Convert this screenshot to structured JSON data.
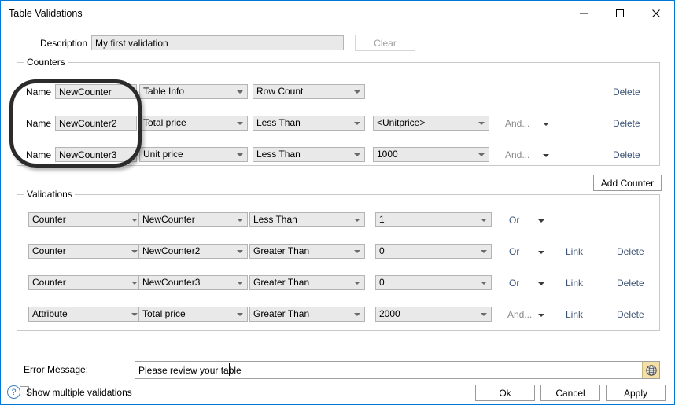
{
  "window": {
    "title": "Table Validations",
    "accent_color": "#0078d7",
    "caption_buttons": [
      {
        "name": "minimize-button",
        "glyph": "minimize-icon"
      },
      {
        "name": "maximize-button",
        "glyph": "maximize-icon"
      },
      {
        "name": "close-button",
        "glyph": "close-icon"
      }
    ]
  },
  "description": {
    "label": "Description",
    "value": "My first validation",
    "placeholder": "",
    "clear_label": "Clear",
    "clear_enabled": false
  },
  "counters": {
    "group_label": "Counters",
    "name_label": "Name",
    "add_button_label": "Add Counter",
    "rows": [
      {
        "name_value": "NewCounter",
        "source": "Table Info",
        "metric": "Row Count",
        "value": "",
        "connector": "",
        "delete_label": "Delete"
      },
      {
        "name_value": "NewCounter2",
        "source": "Total price",
        "metric": "Less Than",
        "value": "<Unitprice>",
        "connector": "And...",
        "delete_label": "Delete"
      },
      {
        "name_value": "NewCounter3",
        "source": "Unit price",
        "metric": "Less Than",
        "value": "1000",
        "connector": "And...",
        "delete_label": "Delete"
      }
    ]
  },
  "validations": {
    "group_label": "Validations",
    "rows": [
      {
        "type": "Counter",
        "target": "NewCounter",
        "operator": "Less Than",
        "value": "1",
        "connector": "Or",
        "link_label": "",
        "delete_label": ""
      },
      {
        "type": "Counter",
        "target": "NewCounter2",
        "operator": "Greater Than",
        "value": "0",
        "connector": "Or",
        "link_label": "Link",
        "delete_label": "Delete"
      },
      {
        "type": "Counter",
        "target": "NewCounter3",
        "operator": "Greater Than",
        "value": "0",
        "connector": "Or",
        "link_label": "Link",
        "delete_label": "Delete"
      },
      {
        "type": "Attribute",
        "target": "Total price",
        "operator": "Greater Than",
        "value": "2000",
        "connector": "And...",
        "link_label": "Link",
        "delete_label": "Delete"
      }
    ]
  },
  "error_message": {
    "label": "Error Message:",
    "value": "Please review your table",
    "placeholder": "",
    "globe_icon": "globe-icon"
  },
  "footer": {
    "help_icon": "help-icon",
    "show_multiple_label": "Show multiple validations",
    "show_multiple_checked": false,
    "ok_label": "Ok",
    "cancel_label": "Cancel",
    "apply_label": "Apply"
  },
  "annotation": {
    "shape": "rounded-rectangle-highlight",
    "color": "#2b2b2b"
  }
}
